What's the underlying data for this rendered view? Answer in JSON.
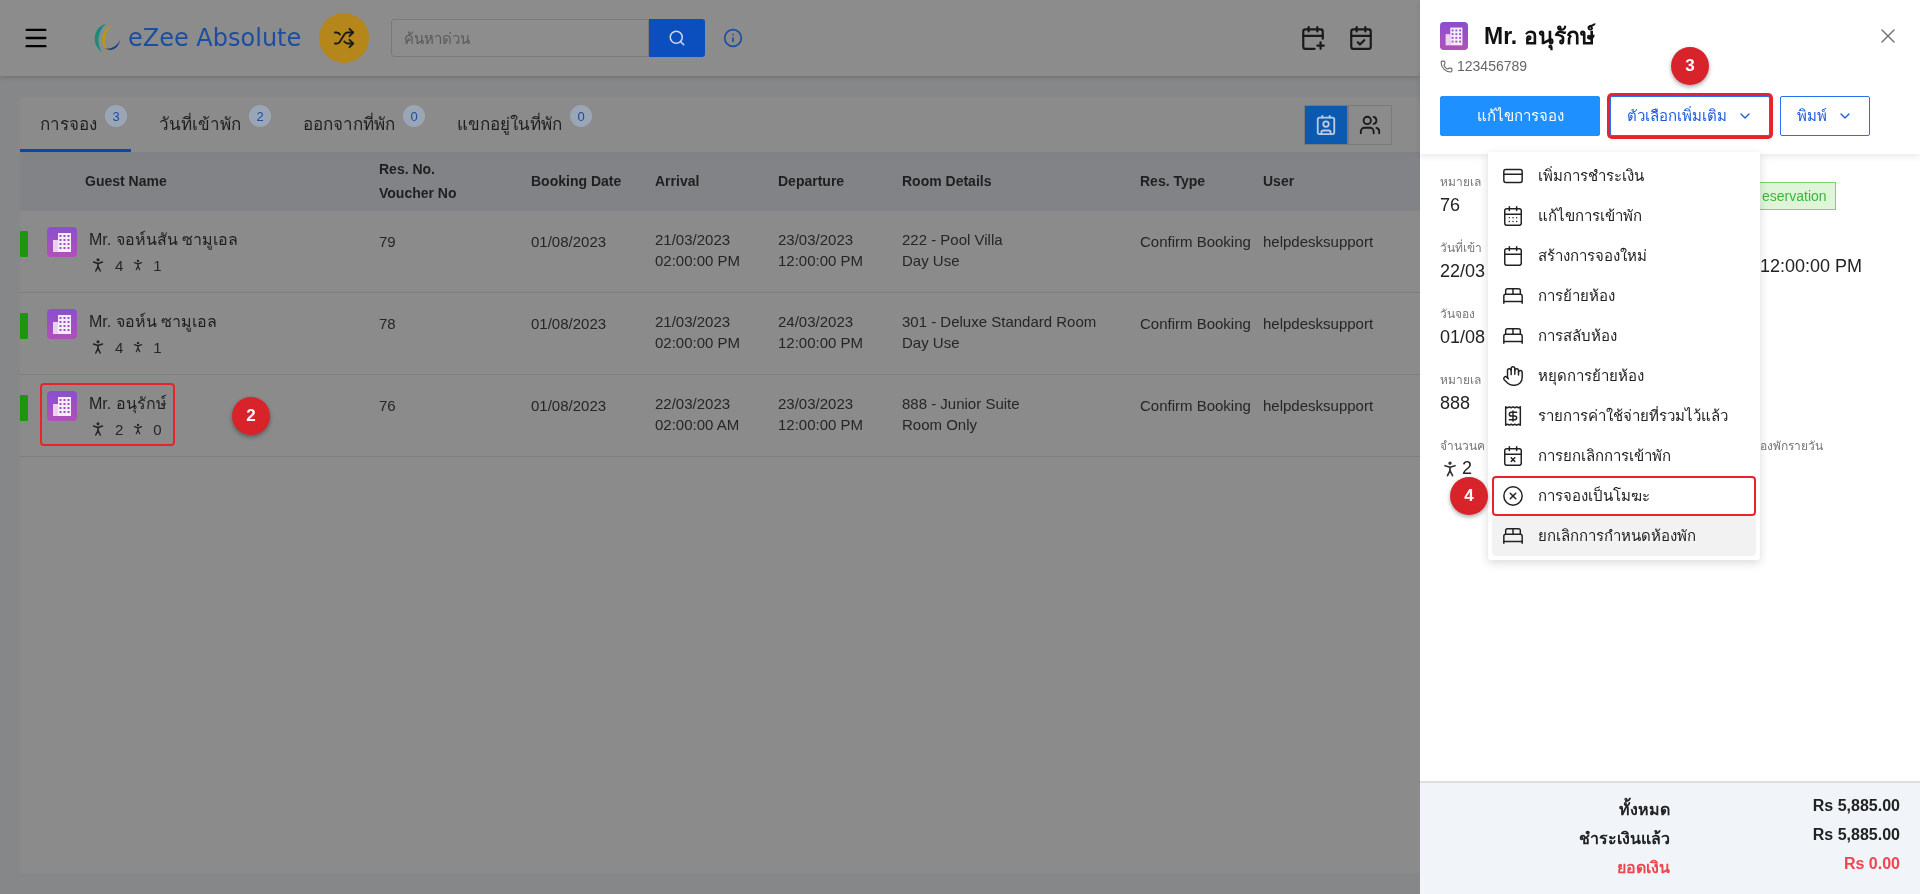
{
  "header": {
    "logo": "eZee Absolute",
    "search": {
      "placeholder": "ค้นหาด่วน"
    }
  },
  "tabs": [
    {
      "label": "การจอง",
      "count": "3",
      "selected": true
    },
    {
      "label": "วันที่เข้าพัก",
      "count": "2",
      "selected": false
    },
    {
      "label": "ออกจากที่พัก",
      "count": "0",
      "selected": false
    },
    {
      "label": "แขกอยู่ในที่พัก",
      "count": "0",
      "selected": false
    }
  ],
  "view_toggles": [
    {
      "selected": true
    },
    {
      "selected": false
    }
  ],
  "table": {
    "columns": [
      "Guest Name",
      "Res. No.\nVoucher No",
      "Booking Date",
      "Arrival",
      "Departure",
      "Room Details",
      "Res. Type",
      "User"
    ],
    "rows": [
      {
        "color": "#1f9410",
        "name": "Mr. จอห์นสัน ซามูเอล",
        "adults": "4",
        "children": "1",
        "res_no": "79",
        "booking_date": "01/08/2023",
        "arrival": {
          "date": "21/03/2023",
          "time": "02:00:00 PM"
        },
        "departure": {
          "date": "23/03/2023",
          "time": "12:00:00 PM"
        },
        "room": "222 - Pool Villa",
        "rate": "Day Use",
        "res_type": "Confirm Booking",
        "user": "helpdesksupport"
      },
      {
        "color": "#1f9410",
        "name": "Mr. จอห์น ซามูเอล",
        "adults": "4",
        "children": "1",
        "res_no": "78",
        "booking_date": "01/08/2023",
        "arrival": {
          "date": "21/03/2023",
          "time": "02:00:00 PM"
        },
        "departure": {
          "date": "24/03/2023",
          "time": "12:00:00 PM"
        },
        "room": "301 - Deluxe Standard Room",
        "rate": "Day Use",
        "res_type": "Confirm Booking",
        "user": "helpdesksupport"
      },
      {
        "color": "#1f9410",
        "name": "Mr. อนุรักษ์",
        "adults": "2",
        "children": "0",
        "res_no": "76",
        "booking_date": "01/08/2023",
        "arrival": {
          "date": "22/03/2023",
          "time": "02:00:00 AM"
        },
        "departure": {
          "date": "23/03/2023",
          "time": "12:00:00 PM"
        },
        "room": "888 - Junior Suite",
        "rate": "Room Only",
        "res_type": "Confirm Booking",
        "user": "helpdesksupport",
        "callout": "2"
      }
    ]
  },
  "drawer": {
    "name": "Mr. อนุรักษ์",
    "phone": "123456789",
    "buttons": [
      {
        "label": "แก้ไขการจอง",
        "kind": "primary"
      },
      {
        "label": "ตัวเลือกเพิ่มเติม",
        "kind": "dropdown",
        "callout": "3"
      },
      {
        "label": "พิมพ์",
        "kind": "dropdown"
      }
    ],
    "details": [
      {
        "label": "หมายเล",
        "value": "76",
        "extra": {
          "kind": "badge",
          "text": "eservation"
        }
      },
      {
        "label": "วันที่เข้า",
        "value": "22/03",
        "extra": {
          "kind": "value",
          "text": "12:00:00 PM"
        }
      },
      {
        "label": "วันจอง",
        "value": "01/08"
      },
      {
        "label": "หมายเล",
        "value": "888"
      },
      {
        "label": "จำนวนค",
        "extra": {
          "kind": "label",
          "text": "องพักรายวัน"
        }
      }
    ],
    "guests": {
      "adults": "2"
    },
    "menu": [
      {
        "label": "เพิ่มการชำระเงิน",
        "hovered": false
      },
      {
        "label": "แก้ไขการเข้าพัก",
        "hovered": false
      },
      {
        "label": "สร้างการจองใหม่",
        "hovered": false
      },
      {
        "label": "การย้ายห้อง",
        "hovered": false
      },
      {
        "label": "การสลับห้อง",
        "hovered": false
      },
      {
        "label": "หยุดการย้ายห้อง",
        "hovered": false
      },
      {
        "label": "รายการค่าใช้จ่ายที่รวมไว้แล้ว",
        "hovered": false
      },
      {
        "label": "การยกเลิกการเข้าพัก",
        "hovered": false
      },
      {
        "label": "การจองเป็นโมฆะ",
        "hovered": false,
        "callout": "4"
      },
      {
        "label": "ยกเลิกการกำหนดห้องพัก",
        "hovered": true
      }
    ],
    "totals": [
      {
        "label": "ทั้งหมด",
        "value": "Rs 5,885.00",
        "kind": "normal"
      },
      {
        "label": "ชำระเงินแล้ว",
        "value": "Rs 5,885.00",
        "kind": "normal"
      },
      {
        "label": "ยอดเงิน",
        "value": "Rs 0.00",
        "kind": "due"
      }
    ]
  }
}
